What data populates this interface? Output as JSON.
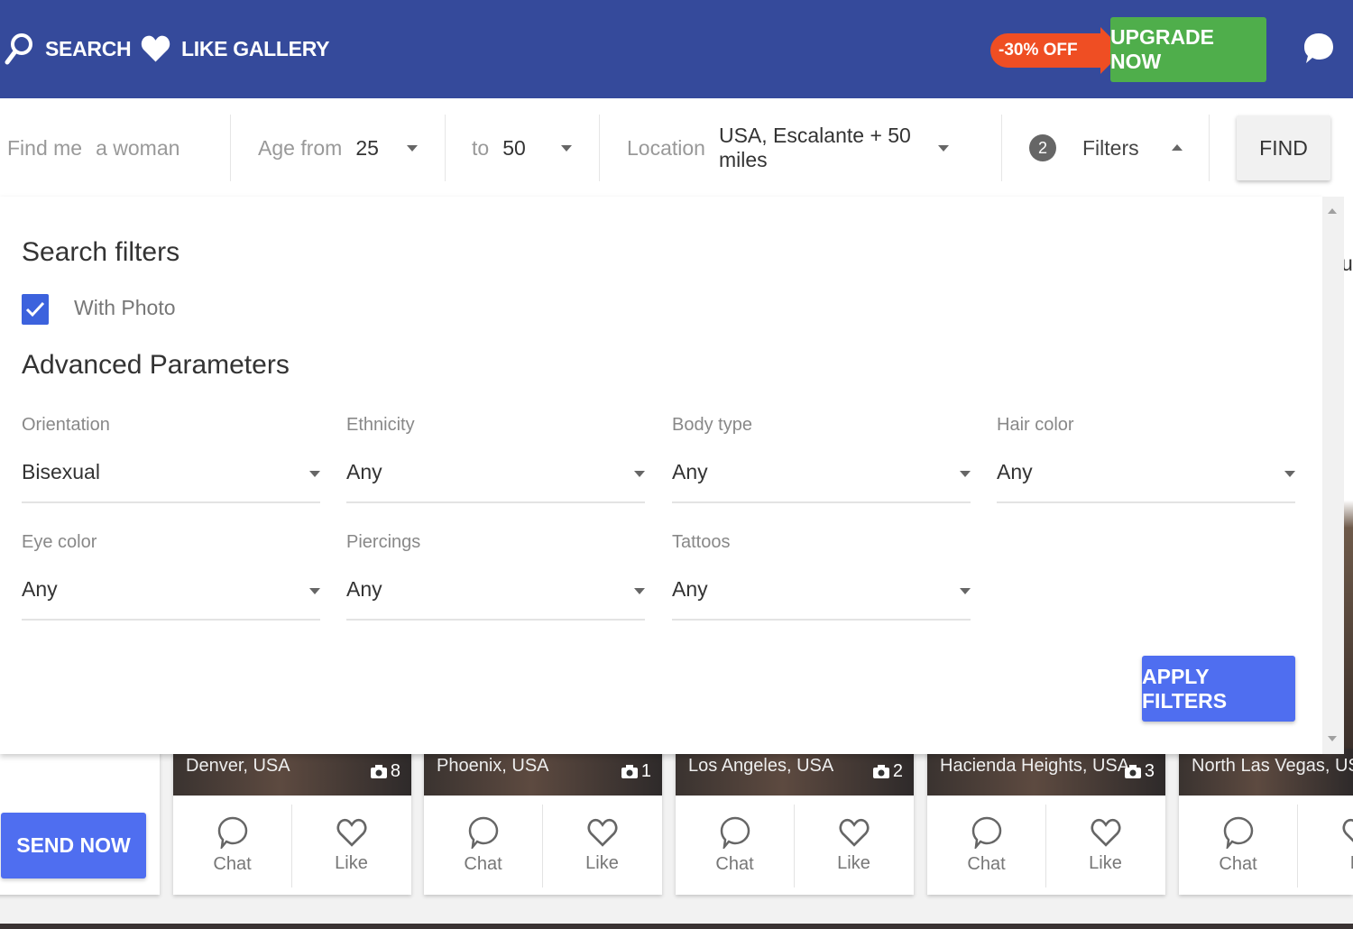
{
  "nav": {
    "search_label": "SEARCH",
    "like_gallery_label": "LIKE GALLERY",
    "discount": "-30% OFF",
    "upgrade_label": "UPGRADE NOW",
    "chat_icon": "chat-bubble-icon"
  },
  "search_bar": {
    "find_me_label": "Find me",
    "find_me_value": "a woman",
    "age_from_label": "Age from",
    "age_from_value": "25",
    "age_to_label": "to",
    "age_to_value": "50",
    "location_label": "Location",
    "location_value": "USA, Escalante + 50 miles",
    "filters_count": "2",
    "filters_label": "Filters",
    "find_label": "FIND"
  },
  "filters": {
    "title": "Search filters",
    "with_photo_label": "With Photo",
    "with_photo_checked": true,
    "advanced_title": "Advanced Parameters",
    "fields": [
      {
        "label": "Orientation",
        "value": "Bisexual"
      },
      {
        "label": "Ethnicity",
        "value": "Any"
      },
      {
        "label": "Body type",
        "value": "Any"
      },
      {
        "label": "Hair color",
        "value": "Any"
      },
      {
        "label": "Eye color",
        "value": "Any"
      },
      {
        "label": "Piercings",
        "value": "Any"
      },
      {
        "label": "Tattoos",
        "value": "Any"
      }
    ],
    "apply_label": "APPLY FILTERS"
  },
  "background": {
    "send_now_label": "SEND NOW",
    "cut_off_text": "u",
    "cards": [
      {
        "location": "Denver, USA",
        "photos": "8",
        "chat": "Chat",
        "like": "Like"
      },
      {
        "location": "Phoenix, USA",
        "photos": "1",
        "chat": "Chat",
        "like": "Like"
      },
      {
        "location": "Los Angeles, USA",
        "photos": "2",
        "chat": "Chat",
        "like": "Like"
      },
      {
        "location": "Hacienda Heights, USA",
        "photos": "3",
        "chat": "Chat",
        "like": "Like"
      },
      {
        "location": "North Las Vegas, USA",
        "photos": "",
        "chat": "Chat",
        "like": "Li"
      }
    ]
  },
  "colors": {
    "header_bg": "#354a9b",
    "upgrade_green": "#4fae4b",
    "discount_orange": "#ef4e23",
    "primary_button": "#4f6ef0",
    "checkbox_blue": "#3c62dd"
  }
}
